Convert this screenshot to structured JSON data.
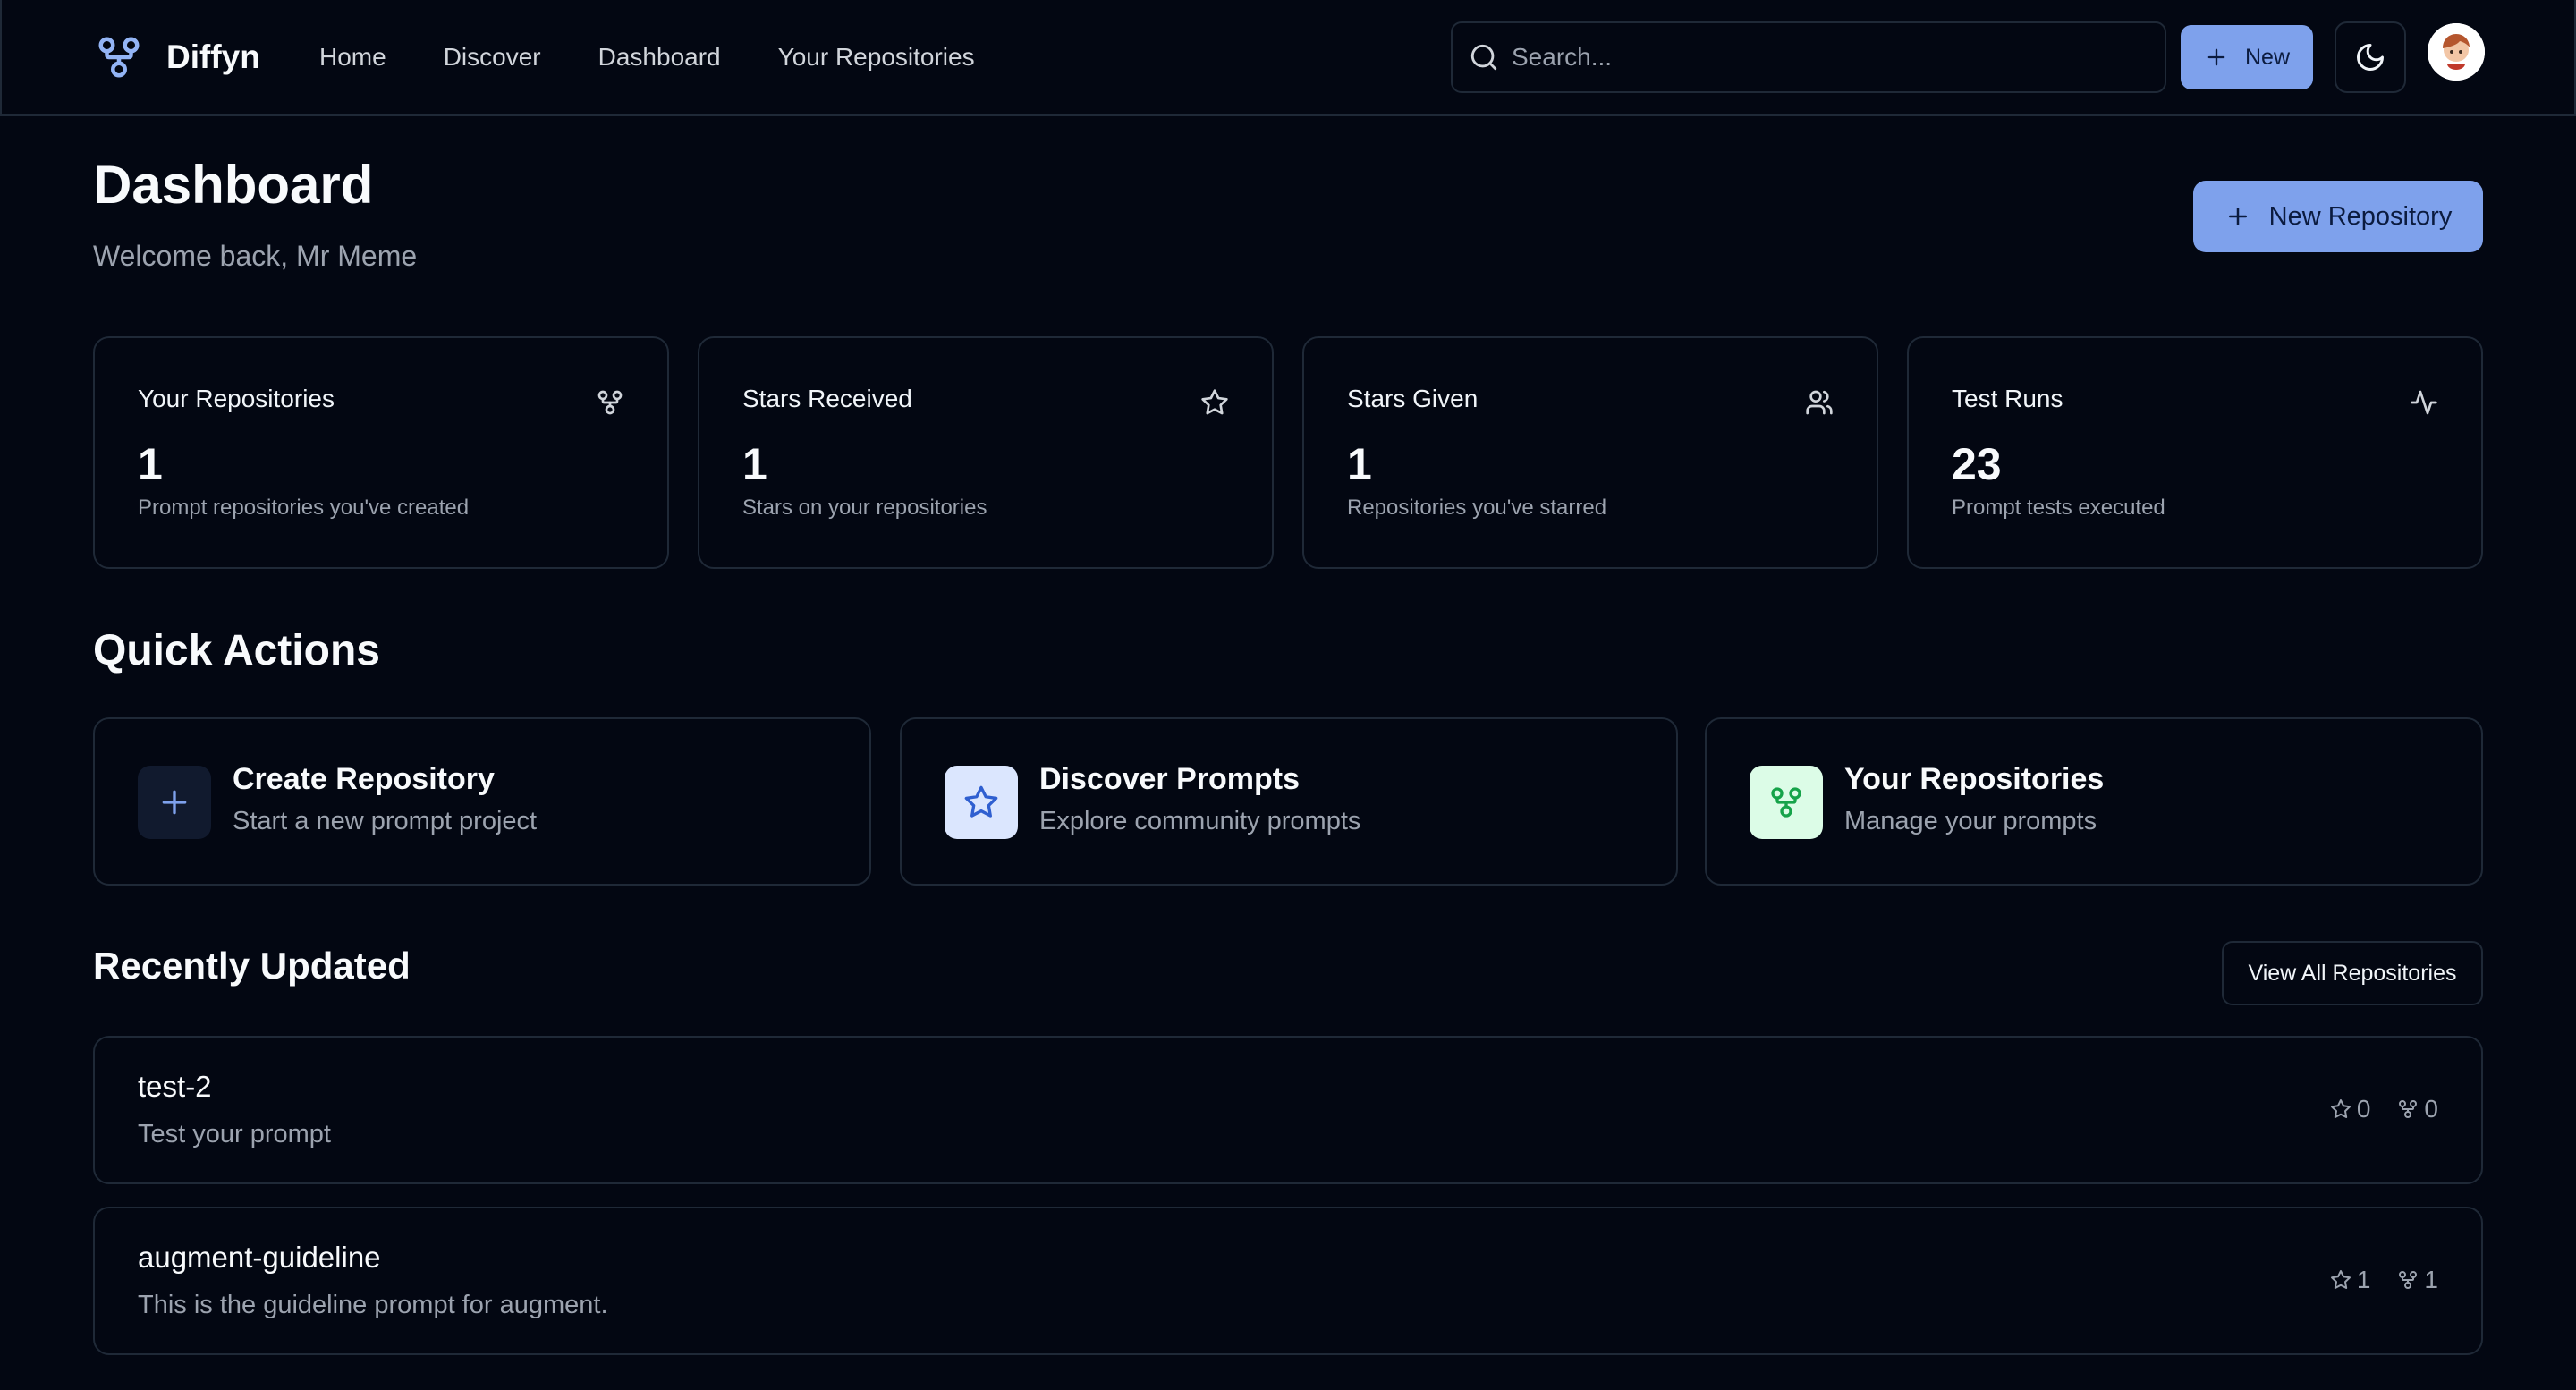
{
  "app": {
    "name": "Diffyn"
  },
  "nav": {
    "items": [
      "Home",
      "Discover",
      "Dashboard",
      "Your Repositories"
    ]
  },
  "search": {
    "placeholder": "Search..."
  },
  "header_actions": {
    "new_label": "New"
  },
  "page": {
    "title": "Dashboard",
    "welcome": "Welcome back, Mr Meme",
    "new_repo_label": "New Repository"
  },
  "stats": [
    {
      "title": "Your Repositories",
      "value": "1",
      "desc": "Prompt repositories you've created",
      "icon": "git-fork-icon"
    },
    {
      "title": "Stars Received",
      "value": "1",
      "desc": "Stars on your repositories",
      "icon": "star-icon"
    },
    {
      "title": "Stars Given",
      "value": "1",
      "desc": "Repositories you've starred",
      "icon": "users-icon"
    },
    {
      "title": "Test Runs",
      "value": "23",
      "desc": "Prompt tests executed",
      "icon": "activity-icon"
    }
  ],
  "quick_actions": {
    "title": "Quick Actions",
    "items": [
      {
        "title": "Create Repository",
        "desc": "Start a new prompt project",
        "icon": "plus-icon"
      },
      {
        "title": "Discover Prompts",
        "desc": "Explore community prompts",
        "icon": "star-icon"
      },
      {
        "title": "Your Repositories",
        "desc": "Manage your prompts",
        "icon": "git-fork-icon"
      }
    ]
  },
  "recent": {
    "title": "Recently Updated",
    "view_all_label": "View All Repositories",
    "repos": [
      {
        "name": "test-2",
        "desc": "Test your prompt",
        "stars": "0",
        "forks": "0"
      },
      {
        "name": "augment-guideline",
        "desc": "This is the guideline prompt for augment.",
        "stars": "1",
        "forks": "1"
      }
    ]
  },
  "colors": {
    "background": "#030712",
    "border": "#1f2937",
    "accent": "#7ea1ec",
    "muted_text": "#9ca3af",
    "brand_icon": "#93b4f5"
  }
}
